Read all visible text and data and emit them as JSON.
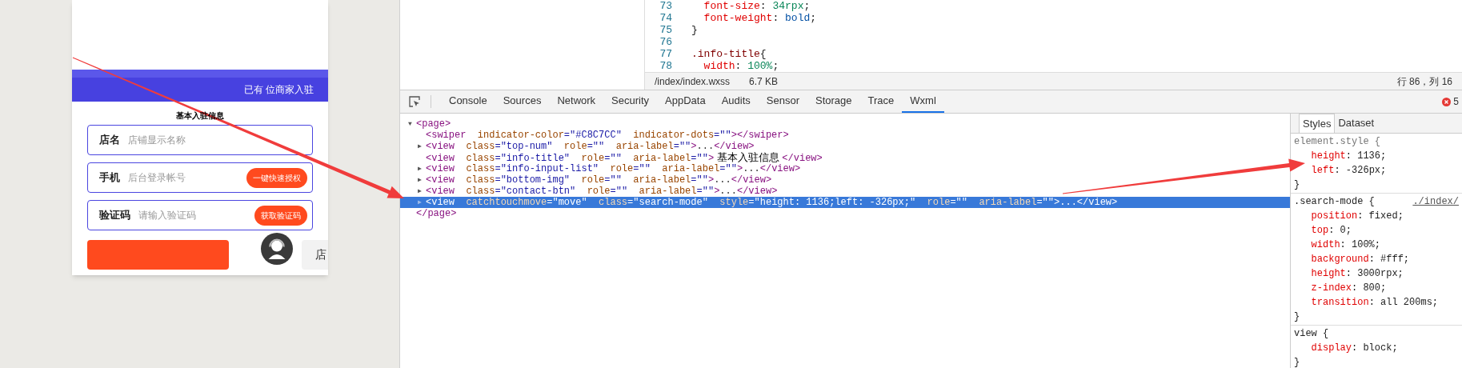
{
  "simulator": {
    "banner_text": "已有 位商家入驻",
    "section_title": "基本入驻信息",
    "fields": [
      {
        "label": "店名",
        "placeholder": "店铺显示名称"
      },
      {
        "label": "手机",
        "placeholder": "后台登录帐号",
        "button": "一键快速授权"
      },
      {
        "label": "验证码",
        "placeholder": "请输入验证码",
        "button": "获取验证码"
      }
    ],
    "secondary_button": "店"
  },
  "editor": {
    "lines": [
      {
        "number": "73",
        "tokens": [
          {
            "kind": "property",
            "text": "  font-size"
          },
          {
            "kind": "punct",
            "text": ": "
          },
          {
            "kind": "number",
            "text": "34rpx"
          },
          {
            "kind": "punct",
            "text": ";"
          }
        ]
      },
      {
        "number": "74",
        "tokens": [
          {
            "kind": "property",
            "text": "  font-weight"
          },
          {
            "kind": "punct",
            "text": ": "
          },
          {
            "kind": "keyword",
            "text": "bold"
          },
          {
            "kind": "punct",
            "text": ";"
          }
        ]
      },
      {
        "number": "75",
        "tokens": [
          {
            "kind": "punct",
            "text": "}"
          }
        ]
      },
      {
        "number": "76"
      },
      {
        "number": "77",
        "tokens": [
          {
            "kind": "selector",
            "text": ".info-title"
          },
          {
            "kind": "punct",
            "text": "{"
          }
        ]
      },
      {
        "number": "78",
        "tokens": [
          {
            "kind": "property",
            "text": "  width"
          },
          {
            "kind": "punct",
            "text": ": "
          },
          {
            "kind": "number",
            "text": "100%"
          },
          {
            "kind": "punct",
            "text": ";"
          }
        ]
      }
    ],
    "file_path": "/index/index.wxss",
    "file_size": "6.7 KB",
    "cursor": "行 86，列 16"
  },
  "devtools": {
    "tabs": [
      {
        "label": "Console",
        "selected": false
      },
      {
        "label": "Sources",
        "selected": false
      },
      {
        "label": "Network",
        "selected": false
      },
      {
        "label": "Security",
        "selected": false
      },
      {
        "label": "AppData",
        "selected": false
      },
      {
        "label": "Audits",
        "selected": false
      },
      {
        "label": "Sensor",
        "selected": false
      },
      {
        "label": "Storage",
        "selected": false
      },
      {
        "label": "Trace",
        "selected": false
      },
      {
        "label": "Wxml",
        "selected": true
      }
    ],
    "error_count": "5",
    "tree": [
      {
        "arrow": "▼",
        "selected": false,
        "tokens": [
          {
            "kind": "tag",
            "text": "<page>"
          }
        ],
        "children": [
          {
            "selected": false,
            "tokens": [
              {
                "kind": "tag",
                "text": "<swiper"
              },
              {
                "kind": "attr",
                "text": "  indicator-color"
              },
              {
                "kind": "value",
                "text": "=\"#C8C7CC\""
              },
              {
                "kind": "attr",
                "text": "  indicator-dots"
              },
              {
                "kind": "value",
                "text": "=\"\""
              },
              {
                "kind": "tag",
                "text": "></swiper>"
              }
            ]
          },
          {
            "arrow": "▶",
            "selected": false,
            "tokens": [
              {
                "kind": "tag",
                "text": "<view"
              },
              {
                "kind": "attr",
                "text": "  class"
              },
              {
                "kind": "value",
                "text": "=\"top-num\""
              },
              {
                "kind": "attr",
                "text": "  role"
              },
              {
                "kind": "value",
                "text": "=\"\""
              },
              {
                "kind": "attr",
                "text": "  aria-label"
              },
              {
                "kind": "value",
                "text": "=\"\""
              },
              {
                "kind": "tag",
                "text": ">"
              },
              {
                "kind": "punct",
                "text": "..."
              },
              {
                "kind": "tag",
                "text": "</view>"
              }
            ]
          },
          {
            "selected": false,
            "tokens": [
              {
                "kind": "tag",
                "text": "<view"
              },
              {
                "kind": "attr",
                "text": "  class"
              },
              {
                "kind": "value",
                "text": "=\"info-title\""
              },
              {
                "kind": "attr",
                "text": "  role"
              },
              {
                "kind": "value",
                "text": "=\"\""
              },
              {
                "kind": "attr",
                "text": "  aria-label"
              },
              {
                "kind": "value",
                "text": "=\"\""
              },
              {
                "kind": "tag",
                "text": ">"
              },
              {
                "kind": "text",
                "text": " 基本入驻信息 "
              },
              {
                "kind": "tag",
                "text": "</view>"
              }
            ]
          },
          {
            "arrow": "▶",
            "selected": false,
            "tokens": [
              {
                "kind": "tag",
                "text": "<view"
              },
              {
                "kind": "attr",
                "text": "  class"
              },
              {
                "kind": "value",
                "text": "=\"info-input-list\""
              },
              {
                "kind": "attr",
                "text": "  role"
              },
              {
                "kind": "value",
                "text": "=\"\""
              },
              {
                "kind": "attr",
                "text": "  aria-label"
              },
              {
                "kind": "value",
                "text": "=\"\""
              },
              {
                "kind": "tag",
                "text": ">"
              },
              {
                "kind": "punct",
                "text": "..."
              },
              {
                "kind": "tag",
                "text": "</view>"
              }
            ]
          },
          {
            "arrow": "▶",
            "selected": false,
            "tokens": [
              {
                "kind": "tag",
                "text": "<view"
              },
              {
                "kind": "attr",
                "text": "  class"
              },
              {
                "kind": "value",
                "text": "=\"bottom-img\""
              },
              {
                "kind": "attr",
                "text": "  role"
              },
              {
                "kind": "value",
                "text": "=\"\""
              },
              {
                "kind": "attr",
                "text": "  aria-label"
              },
              {
                "kind": "value",
                "text": "=\"\""
              },
              {
                "kind": "tag",
                "text": ">"
              },
              {
                "kind": "punct",
                "text": "..."
              },
              {
                "kind": "tag",
                "text": "</view>"
              }
            ]
          },
          {
            "arrow": "▶",
            "selected": false,
            "tokens": [
              {
                "kind": "tag",
                "text": "<view"
              },
              {
                "kind": "attr",
                "text": "  class"
              },
              {
                "kind": "value",
                "text": "=\"contact-btn\""
              },
              {
                "kind": "attr",
                "text": "  role"
              },
              {
                "kind": "value",
                "text": "=\"\""
              },
              {
                "kind": "attr",
                "text": "  aria-label"
              },
              {
                "kind": "value",
                "text": "=\"\""
              },
              {
                "kind": "tag",
                "text": ">"
              },
              {
                "kind": "punct",
                "text": "..."
              },
              {
                "kind": "tag",
                "text": "</view>"
              }
            ]
          },
          {
            "arrow": "▶",
            "selected": true,
            "tokens": [
              {
                "kind": "tag",
                "text": "<view"
              },
              {
                "kind": "attr",
                "text": "  catchtouchmove"
              },
              {
                "kind": "value",
                "text": "=\"move\""
              },
              {
                "kind": "attr",
                "text": "  class"
              },
              {
                "kind": "value",
                "text": "=\"search-mode\""
              },
              {
                "kind": "attr",
                "text": "  style"
              },
              {
                "kind": "value",
                "text": "=\"height: 1136;left: -326px;\""
              },
              {
                "kind": "attr",
                "text": "  role"
              },
              {
                "kind": "value",
                "text": "=\"\""
              },
              {
                "kind": "attr",
                "text": "  aria-label"
              },
              {
                "kind": "value",
                "text": "=\"\""
              },
              {
                "kind": "tag",
                "text": ">"
              },
              {
                "kind": "punct",
                "text": "..."
              },
              {
                "kind": "tag",
                "text": "</view>"
              }
            ]
          }
        ]
      },
      {
        "selected": false,
        "tokens": [
          {
            "kind": "tag",
            "text": "</page>"
          }
        ]
      }
    ],
    "side_tabs": [
      {
        "label": "Styles",
        "selected": true
      },
      {
        "label": "Dataset",
        "selected": false
      }
    ],
    "rules": [
      {
        "lines": [
          [
            {
              "kind": "muted",
              "text": "element.style {"
            }
          ],
          [
            {
              "kind": "property",
              "text": "   height"
            },
            {
              "kind": "punct",
              "text": ": 1136;"
            }
          ],
          [
            {
              "kind": "property",
              "text": "   left"
            },
            {
              "kind": "punct",
              "text": ": -326px;"
            }
          ],
          [
            {
              "kind": "punct",
              "text": "}"
            }
          ]
        ]
      },
      {
        "source": "./index/",
        "lines": [
          [
            {
              "kind": "punct",
              "text": ".search-mode {"
            }
          ],
          [
            {
              "kind": "property",
              "text": "   position"
            },
            {
              "kind": "punct",
              "text": ": fixed;"
            }
          ],
          [
            {
              "kind": "property",
              "text": "   top"
            },
            {
              "kind": "punct",
              "text": ": 0;"
            }
          ],
          [
            {
              "kind": "property",
              "text": "   width"
            },
            {
              "kind": "punct",
              "text": ": 100%;"
            }
          ],
          [
            {
              "kind": "property",
              "text": "   background"
            },
            {
              "kind": "punct",
              "text": ": #fff;"
            }
          ],
          [
            {
              "kind": "property",
              "text": "   height"
            },
            {
              "kind": "punct",
              "text": ": 3000rpx;"
            }
          ],
          [
            {
              "kind": "property",
              "text": "   z-index"
            },
            {
              "kind": "punct",
              "text": ": 800;"
            }
          ],
          [
            {
              "kind": "property",
              "text": "   transition"
            },
            {
              "kind": "punct",
              "text": ": all 200ms;"
            }
          ],
          [
            {
              "kind": "punct",
              "text": "}"
            }
          ]
        ]
      },
      {
        "lines": [
          [
            {
              "kind": "punct",
              "text": "view {"
            }
          ],
          [
            {
              "kind": "property",
              "text": "   display"
            },
            {
              "kind": "punct",
              "text": ": block;"
            }
          ],
          [
            {
              "kind": "punct",
              "text": "}"
            }
          ]
        ]
      }
    ]
  }
}
